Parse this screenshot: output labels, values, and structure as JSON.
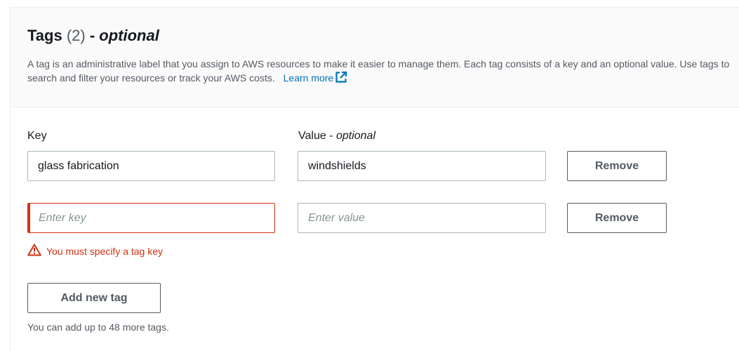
{
  "header": {
    "title": "Tags",
    "count": "(2)",
    "separator": " - ",
    "optional": "optional",
    "description": "A tag is an administrative label that you assign to AWS resources to make it easier to manage them. Each tag consists of a key and an optional value. Use tags to search and filter your resources or track your AWS costs.",
    "learn_more": "Learn more"
  },
  "columns": {
    "key_label": "Key",
    "value_label": "Value - ",
    "value_optional": "optional"
  },
  "tags": [
    {
      "key": "glass fabrication",
      "key_placeholder": "Enter key",
      "value": "windshields",
      "value_placeholder": "Enter value",
      "remove_label": "Remove"
    },
    {
      "key": "",
      "key_placeholder": "Enter key",
      "value": "",
      "value_placeholder": "Enter value",
      "remove_label": "Remove",
      "error": "You must specify a tag key"
    }
  ],
  "add_tag_label": "Add new tag",
  "hint": "You can add up to 48 more tags.",
  "colors": {
    "error": "#d13212",
    "link": "#0073bb",
    "text": "#16191f",
    "secondary_text": "#545b64",
    "input_border": "#aab7b8"
  },
  "icons": {
    "external_link": "external-link-icon",
    "warning": "warning-icon"
  }
}
